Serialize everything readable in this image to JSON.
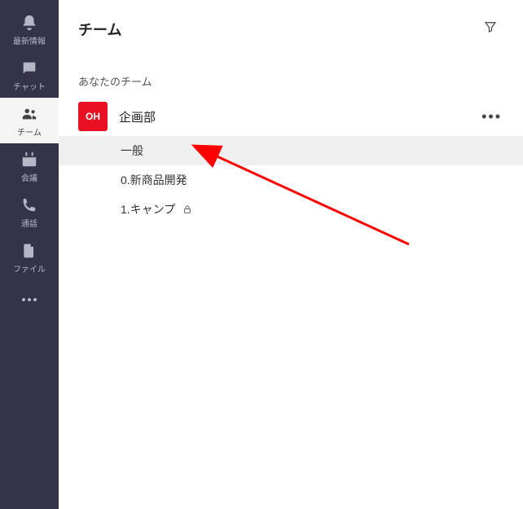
{
  "sidebar": {
    "items": [
      {
        "label": "最新情報",
        "icon": "bell"
      },
      {
        "label": "チャット",
        "icon": "chat"
      },
      {
        "label": "チーム",
        "icon": "teams"
      },
      {
        "label": "会議",
        "icon": "calendar"
      },
      {
        "label": "通話",
        "icon": "call"
      },
      {
        "label": "ファイル",
        "icon": "file"
      }
    ],
    "active_index": 2
  },
  "header": {
    "title": "チーム"
  },
  "section_label": "あなたのチーム",
  "team": {
    "avatar_text": "OH",
    "avatar_color": "#e81123",
    "name": "企画部"
  },
  "channels": [
    {
      "name": "一般",
      "selected": true,
      "private": false
    },
    {
      "name": "0.新商品開発",
      "selected": false,
      "private": false
    },
    {
      "name": "1.キャンプ",
      "selected": false,
      "private": true
    }
  ]
}
